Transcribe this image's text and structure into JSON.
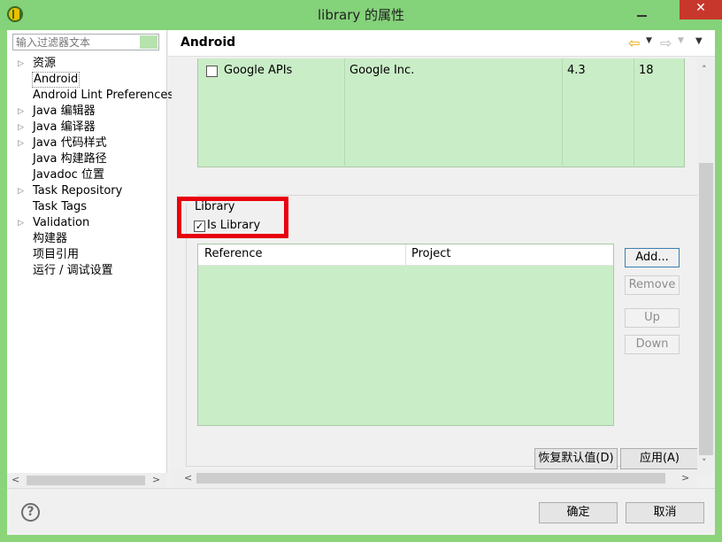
{
  "window": {
    "title": "library 的属性",
    "minimize": "minimize",
    "close": "✕"
  },
  "filter": {
    "placeholder": "输入过滤器文本"
  },
  "tree": [
    {
      "label": "资源",
      "arrow": "▷"
    },
    {
      "label": "Android",
      "arrow": "",
      "selected": true
    },
    {
      "label": "Android Lint Preferences",
      "arrow": ""
    },
    {
      "label": "Java 编辑器",
      "arrow": "▷"
    },
    {
      "label": "Java 编译器",
      "arrow": "▷"
    },
    {
      "label": "Java 代码样式",
      "arrow": "▷"
    },
    {
      "label": "Java 构建路径",
      "arrow": ""
    },
    {
      "label": "Javadoc 位置",
      "arrow": ""
    },
    {
      "label": "Task Repository",
      "arrow": "▷"
    },
    {
      "label": "Task Tags",
      "arrow": ""
    },
    {
      "label": "Validation",
      "arrow": "▷"
    },
    {
      "label": "构建器",
      "arrow": ""
    },
    {
      "label": "项目引用",
      "arrow": ""
    },
    {
      "label": "运行 / 调试设置",
      "arrow": ""
    }
  ],
  "header": {
    "title": "Android"
  },
  "target_row": {
    "name": "Google APIs",
    "vendor": "Google Inc.",
    "platform": "4.3",
    "api": "18",
    "checked": false
  },
  "library": {
    "group_label": "Library",
    "is_library_label": "Is Library",
    "is_library_checked": true
  },
  "ref_table": {
    "columns": [
      "Reference",
      "Project"
    ],
    "rows": []
  },
  "side_buttons": {
    "add": "Add...",
    "remove": "Remove",
    "up": "Up",
    "down": "Down"
  },
  "page_buttons": {
    "restore_defaults": "恢复默认值(D)",
    "apply": "应用(A)"
  },
  "dialog_buttons": {
    "ok": "确定",
    "cancel": "取消"
  },
  "icons": {
    "app": "eclipse-icon",
    "help": "help-icon",
    "back": "nav-back-icon",
    "forward": "nav-forward-icon",
    "menu": "view-menu-icon"
  },
  "colors": {
    "titlebar": "#84d27a",
    "table_fill": "#c9edc6",
    "highlight": "#e8000d",
    "close": "#c7372c"
  }
}
